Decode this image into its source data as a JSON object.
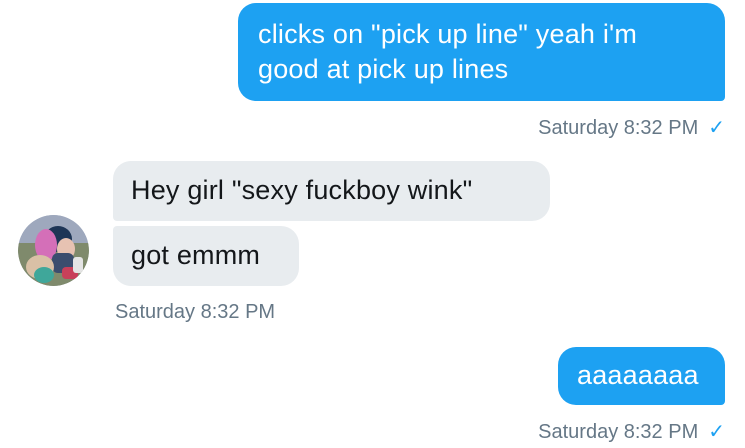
{
  "messages": [
    {
      "direction": "sent",
      "text": "clicks on \"pick up line\" yeah i'm good at pick up lines"
    },
    {
      "direction": "received",
      "text": "Hey girl \"sexy fuckboy wink\""
    },
    {
      "direction": "received",
      "text": "got emmm"
    },
    {
      "direction": "sent",
      "text": "aaaaaaaa"
    }
  ],
  "timestamps": {
    "first_sent": "Saturday 8:32 PM",
    "received_group": "Saturday 8:32 PM",
    "last_sent": "Saturday 8:32 PM"
  },
  "status_icon": "checkmark-icon",
  "status_glyph": "✓",
  "colors": {
    "sent_bubble": "#1da1f2",
    "received_bubble": "#e8ecef",
    "timestamp": "#657786",
    "check": "#1da1f2"
  }
}
